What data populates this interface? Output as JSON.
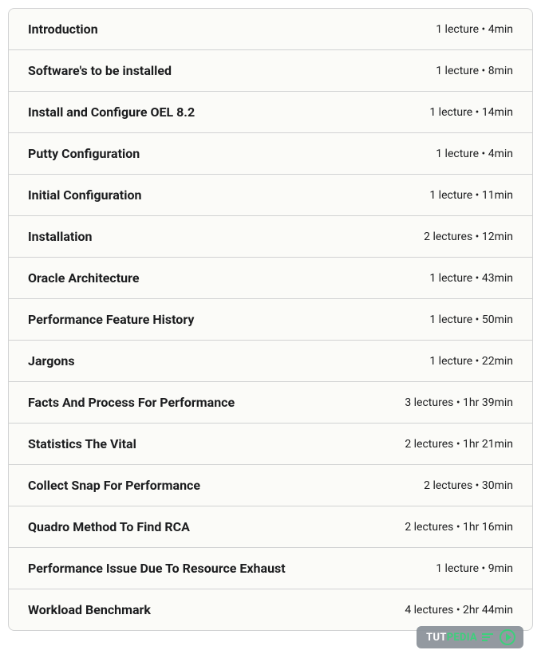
{
  "sections": [
    {
      "title": "Introduction",
      "meta": "1 lecture • 4min"
    },
    {
      "title": "Software's to be installed",
      "meta": "1 lecture • 8min"
    },
    {
      "title": "Install and Configure OEL 8.2",
      "meta": "1 lecture • 14min"
    },
    {
      "title": "Putty Configuration",
      "meta": "1 lecture • 4min"
    },
    {
      "title": "Initial Configuration",
      "meta": "1 lecture • 11min"
    },
    {
      "title": "Installation",
      "meta": "2 lectures • 12min"
    },
    {
      "title": "Oracle Architecture",
      "meta": "1 lecture • 43min"
    },
    {
      "title": "Performance Feature History",
      "meta": "1 lecture • 50min"
    },
    {
      "title": "Jargons",
      "meta": "1 lecture • 22min"
    },
    {
      "title": "Facts And Process For Performance",
      "meta": "3 lectures • 1hr 39min"
    },
    {
      "title": "Statistics The Vital",
      "meta": "2 lectures • 1hr 21min"
    },
    {
      "title": "Collect Snap For Performance",
      "meta": "2 lectures • 30min"
    },
    {
      "title": "Quadro Method To Find RCA",
      "meta": "2 lectures • 1hr 16min"
    },
    {
      "title": "Performance Issue Due To Resource Exhaust",
      "meta": "1 lecture • 9min"
    },
    {
      "title": "Workload Benchmark",
      "meta": "4 lectures • 2hr 44min"
    }
  ],
  "watermark": {
    "part1": "TUT",
    "part2": "PEDIA"
  }
}
